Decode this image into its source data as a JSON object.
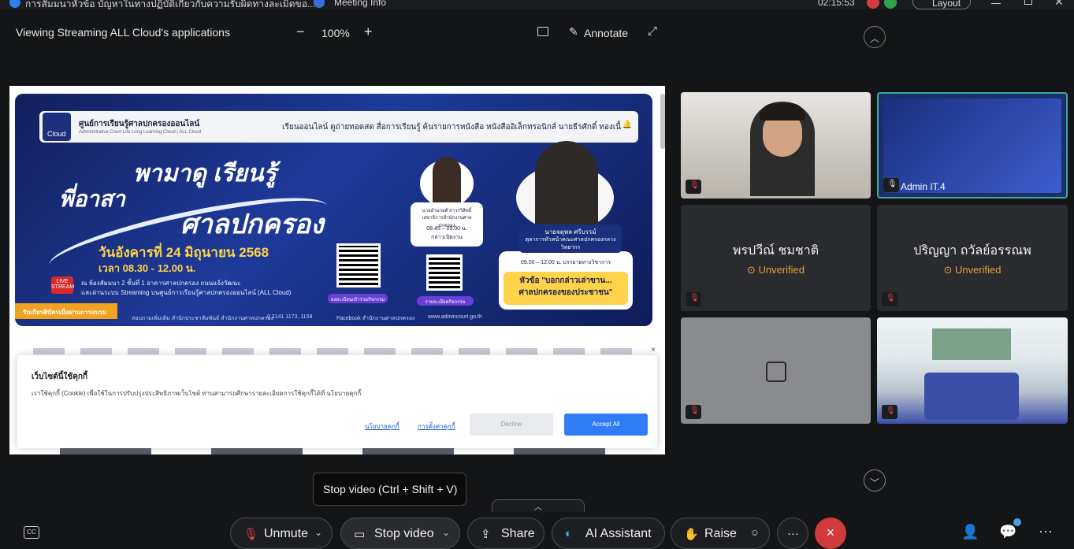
{
  "titlebar": {
    "title": "การสัมมนาหัวข้อ บัญหาในทางปฏิบัติเกี่ยวกับความรับผิดทางละเมิดขอ...",
    "meeting_info": "Meeting Info",
    "clock": "02:15:53",
    "layout_label": "Layout"
  },
  "sharebar": {
    "viewing": "Viewing Streaming ALL Cloud's applications",
    "zoom": "100%",
    "zoom_out": "−",
    "zoom_in": "+",
    "annotate": "Annotate"
  },
  "shared": {
    "nav": {
      "logo_text": "Cloud",
      "org": "ศูนย์การเรียนรู้ศาลปกครองออนไลน์",
      "org_sub": "Administrative Court Life Long Learning Cloud | ALL Cloud",
      "menu": "เรียนออนไลน์   ดูถ่ายทอดสด   สื่อการเรียนรู้   ค้นรายการหนังสือ   หนังสืออิเล็กทรอนิกส์   นายธีรศักดิ์ ทองเนื้",
      "bell": "🔔"
    },
    "banner": {
      "headline_a": "พามาดู เรียนรู้",
      "headline_b": "พี่อาสา",
      "headline_c": "ศาลปกครอง",
      "date": "วันอังคารที่ 24 มิถุนายน 2568",
      "time": "เวลา 08.30 - 12.00 น.",
      "venue1": "ณ ห้องสัมมนา 2 ชั้นที่ 1 อาคารศาลปกครอง ถนนแจ้งวัฒนะ",
      "venue2": "และผ่านระบบ Streaming บนศูนย์การเรียนรู้ศาลปกครองออนไลน์ (ALL Cloud)",
      "live": "LIVE STREAM",
      "cert": "รับเกียรติบัตรเมื่อผ่านการอบรม",
      "footer1": "สอบถามเพิ่มเติม สำนักประชาสัมพันธ์ สำนักงานศาลปกครอง",
      "footer2": "0 2141 1173, 1159",
      "footer3": "Facebook สำนักงานศาลปกครอง",
      "footer4": "www.admincourt.go.th",
      "qr1_label": "ลงทะเบียนเข้าร่วมกิจกรรม",
      "qr2_label": "รายละเอียดกิจกรรม",
      "speaker1": {
        "name": "นายอำนวยศ์ ถาวรวิสิทธิ์",
        "role": "เลขาธิการสำนักงานศาลปกครอง",
        "time": "08.45 – 09.00 น.",
        "task": "กล่าวเปิดงาน"
      },
      "speaker2": {
        "name": "นายจตุพล ศรีบรรม์",
        "role1": "ตุลาการหัวหน้าคณะศาลปกครองกลาง",
        "role2": "วิทยากร",
        "time": "09.00 – 12.00 น.   บรรยายทางวิชาการ",
        "topic1": "หัวข้อ \"บอกกล่าวเล่าขาน...",
        "topic2": "ศาลปกครองของประชาชน\""
      }
    },
    "cookie": {
      "close": "×",
      "title": "เว็บไซต์นี้ใช้คุกกี้",
      "body": "เราใช้คุกกี้ (Cookie) เพื่อใช้ในการปรับปรุงประสิทธิภาพเว็บไซต์ ท่านสามารถศึกษารายละเอียดการใช้คุกกี้ได้ที่ นโยบายคุกกี้",
      "policy": "นโยบายคุกกี้",
      "settings": "การตั้งค่าคุกกี้",
      "decline": "Decline",
      "accept": "Accept All"
    }
  },
  "tiles": {
    "t2_label": "Admin IT.4",
    "t3_name": "พรปวีณ์  ชมชาติ",
    "t3_status": "Unverified",
    "t4_name": "ปริญญา ถวัลย์อรรณพ",
    "t4_status": "Unverified"
  },
  "tooltip": "Stop video (Ctrl + Shift + V)",
  "controls": {
    "unmute": "Unmute",
    "stop_video": "Stop video",
    "share": "Share",
    "ai_assistant": "AI Assistant",
    "raise": "Raise",
    "more": "···",
    "end": "×",
    "cc": "CC"
  },
  "colors": {
    "end_red": "#d03b3b",
    "accept_blue": "#2f7cf6",
    "unverified": "#e0a23a",
    "active_border": "#3fa99c"
  }
}
